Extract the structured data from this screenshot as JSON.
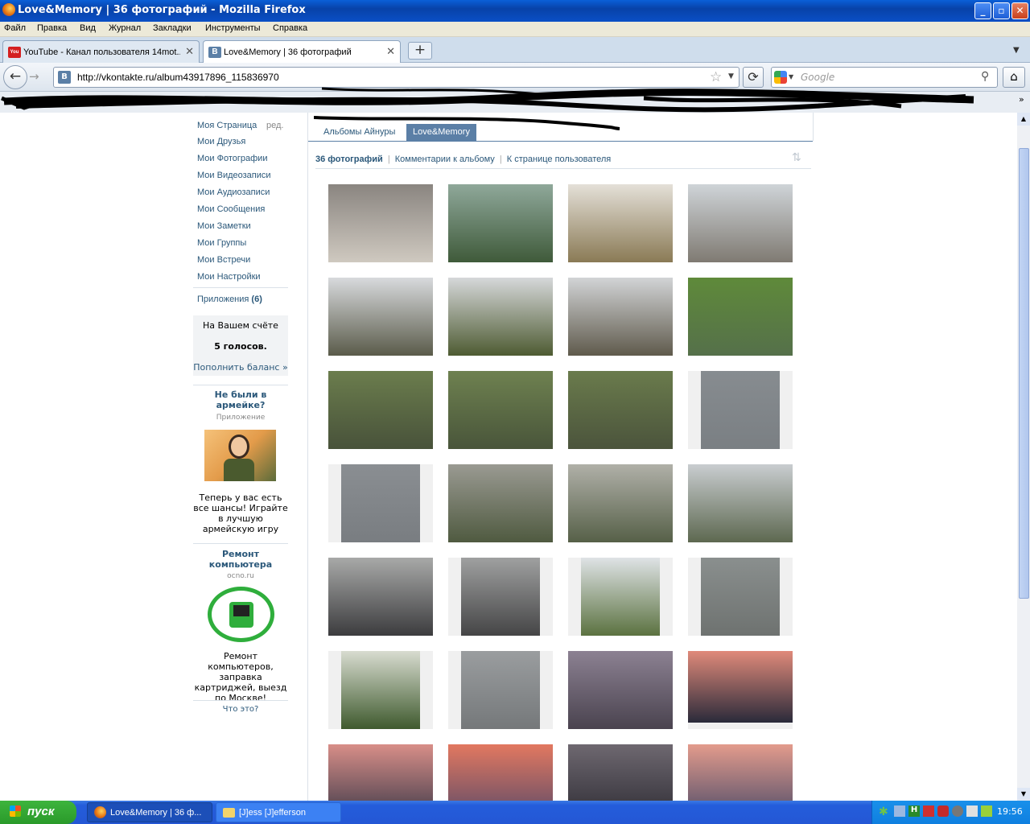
{
  "window": {
    "title": "Love&Memory  |  36 фотографий - Mozilla Firefox"
  },
  "menu": [
    "Файл",
    "Правка",
    "Вид",
    "Журнал",
    "Закладки",
    "Инструменты",
    "Справка"
  ],
  "tabs": [
    {
      "label": "YouTube - Канал пользователя 14mot...",
      "icon": "youtube-favicon",
      "active": false
    },
    {
      "label": "Love&Memory | 36 фотографий",
      "icon": "vk-favicon",
      "active": true
    }
  ],
  "url": "http://vkontakte.ru/album43917896_115836970",
  "search_placeholder": "Google",
  "sidebar": {
    "my_page": "Моя Страница",
    "edit": "ред.",
    "items": [
      "Мои Друзья",
      "Мои Фотографии",
      "Мои Видеозаписи",
      "Мои Аудиозаписи",
      "Мои Сообщения",
      "Мои Заметки",
      "Мои Группы",
      "Мои Встречи",
      "Мои Настройки"
    ],
    "apps_label": "Приложения",
    "apps_count": "(6)",
    "balance_title": "На Вашем счёте",
    "balance_value": "5 голосов.",
    "balance_link": "Пополнить баланс »",
    "ad1_title": "Не были в армейке?",
    "ad1_sub": "Приложение",
    "ad1_text": "Теперь у вас есть все шансы! Играйте в лучшую армейскую игру",
    "ad2_title": "Ремонт компьютера",
    "ad2_sub": "ocno.ru",
    "ad2_text": "Ремонт компьютеров, заправка картриджей, выезд по Москве!",
    "what": "Что это?"
  },
  "album_tabs": [
    "Альбомы Айнуры",
    "Love&Memory"
  ],
  "album_header": {
    "count": "36 фотографий",
    "comments": "Комментарии к альбому",
    "to_user": "К странице пользователя"
  },
  "photos": [
    {
      "name": "cat",
      "c1": "#8a8580",
      "c2": "#cfc9c0"
    },
    {
      "name": "pond",
      "c1": "#8fa89a",
      "c2": "#3f5a3a"
    },
    {
      "name": "field",
      "c1": "#e4e0d8",
      "c2": "#8a7a55"
    },
    {
      "name": "monastery",
      "c1": "#cfd4d8",
      "c2": "#7f7a72"
    },
    {
      "name": "church-trees",
      "c1": "#d8dadd",
      "c2": "#5a5b4a"
    },
    {
      "name": "monastery-wall",
      "c1": "#d6d8da",
      "c2": "#4e5b32"
    },
    {
      "name": "church-dome",
      "c1": "#d2d4d6",
      "c2": "#5f5a4c"
    },
    {
      "name": "river-grass",
      "c1": "#5f8a3a",
      "c2": "#55704a"
    },
    {
      "name": "frog-1",
      "c1": "#6b7d4d",
      "c2": "#48523a"
    },
    {
      "name": "frog-2",
      "c1": "#6e8150",
      "c2": "#49553a"
    },
    {
      "name": "frog-3",
      "c1": "#6a7b4c",
      "c2": "#4b543c"
    },
    {
      "name": "rainbow-1",
      "c1": "#878c90",
      "c2": "#7a7f83",
      "pad": "v"
    },
    {
      "name": "rainbow-2",
      "c1": "#8a8e92",
      "c2": "#797d81",
      "pad": "v"
    },
    {
      "name": "storm-field",
      "c1": "#9a9a92",
      "c2": "#4f5a40"
    },
    {
      "name": "city-wires",
      "c1": "#b0b0a8",
      "c2": "#566048"
    },
    {
      "name": "city-view",
      "c1": "#c9cdd0",
      "c2": "#5d6850"
    },
    {
      "name": "clouds-light",
      "c1": "#a8a9a8",
      "c2": "#3c3c3e"
    },
    {
      "name": "clouds-light-2",
      "c1": "#9fa0a0",
      "c2": "#454546",
      "pad": "v"
    },
    {
      "name": "trees-city",
      "c1": "#dfe3e6",
      "c2": "#5b7240",
      "pad": "v"
    },
    {
      "name": "pigeon",
      "c1": "#8a8f8e",
      "c2": "#6e7270",
      "pad": "v"
    },
    {
      "name": "park-bench",
      "c1": "#d8dcd0",
      "c2": "#3f5a2e",
      "pad": "v"
    },
    {
      "name": "pigeon-fence",
      "c1": "#9a9d9f",
      "c2": "#75787a",
      "pad": "v"
    },
    {
      "name": "purple-cloud",
      "c1": "#8c8192",
      "c2": "#4a434f"
    },
    {
      "name": "sunset-1",
      "c1": "#e08a7a",
      "c2": "#2a2a3a",
      "pad": "h"
    },
    {
      "name": "sunset-2",
      "c1": "#d88e88",
      "c2": "#3a3848"
    },
    {
      "name": "sunset-3",
      "c1": "#e27860",
      "c2": "#5a4a68"
    },
    {
      "name": "sunset-4",
      "c1": "#6e6870",
      "c2": "#2e2c34"
    },
    {
      "name": "sunset-5",
      "c1": "#e39b8c",
      "c2": "#4a4a68"
    }
  ],
  "taskbar": {
    "start": "пуск",
    "tasks": [
      "Love&Memory | 36 ф...",
      "[J]ess [J]efferson"
    ],
    "time": "19:56"
  }
}
